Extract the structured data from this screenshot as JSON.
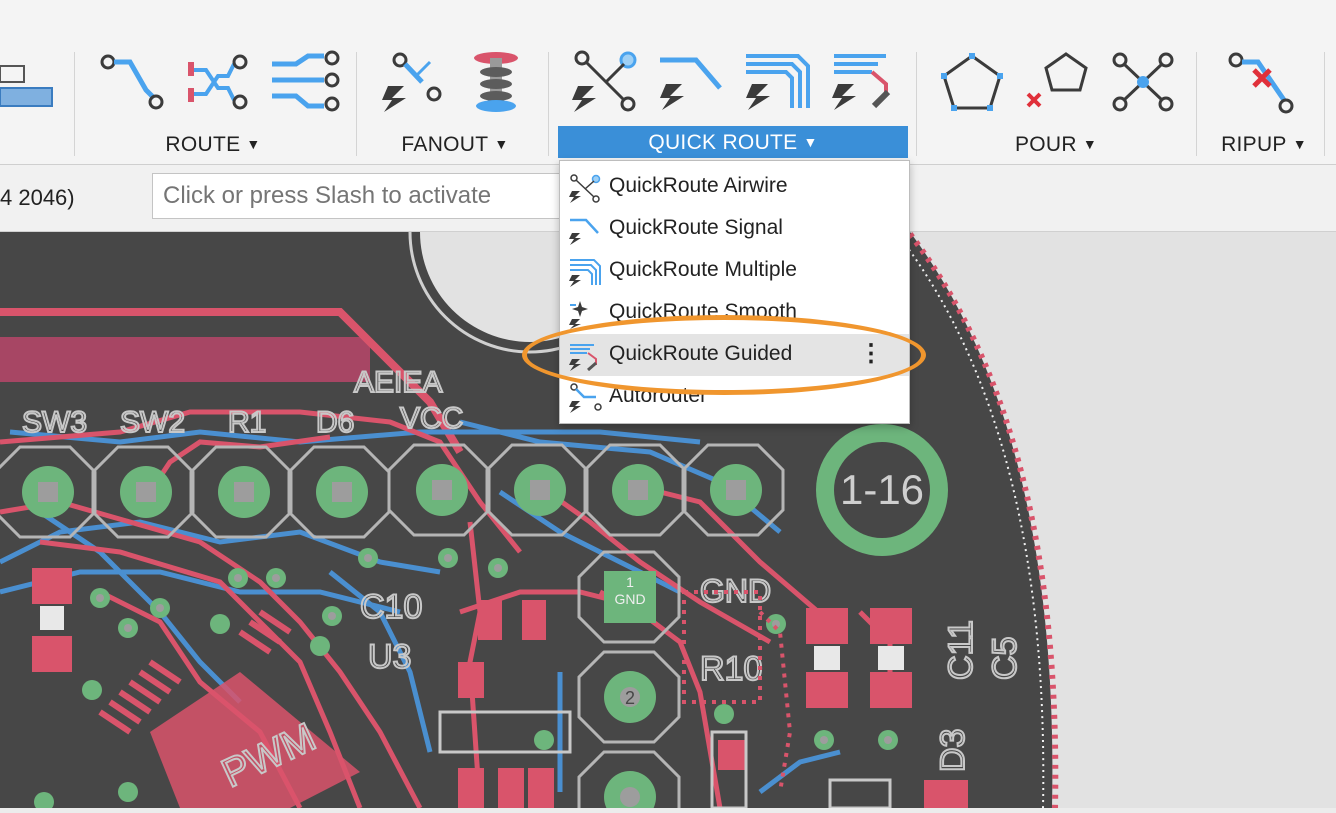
{
  "toolbar": {
    "groups": [
      {
        "label": "ROUTE",
        "tools": [
          "route-manual-icon",
          "route-differential-pair-icon",
          "route-multiple-icon"
        ]
      },
      {
        "label": "FANOUT",
        "tools": [
          "fanout-icon",
          "via-stack-icon"
        ]
      },
      {
        "label": "QUICK ROUTE",
        "tools": [
          "quickroute-airwire-icon",
          "quickroute-signal-icon",
          "quickroute-multiple-icon",
          "quickroute-guided-icon"
        ],
        "active": true
      },
      {
        "label": "POUR",
        "tools": [
          "polygon-icon",
          "ripup-polygon-icon",
          "name-polygon-icon"
        ]
      },
      {
        "label": "RIPUP",
        "tools": [
          "ripup-icon"
        ]
      }
    ],
    "caret": "▼"
  },
  "command_bar": {
    "coordinate": "4 2046)",
    "input_placeholder": "Click or press Slash to activate"
  },
  "dropdown": {
    "items": [
      {
        "label": "QuickRoute Airwire",
        "icon": "airwire-icon"
      },
      {
        "label": "QuickRoute Signal",
        "icon": "signal-icon"
      },
      {
        "label": "QuickRoute Multiple",
        "icon": "multiple-icon"
      },
      {
        "label": "QuickRoute Smooth",
        "icon": "smooth-icon"
      },
      {
        "label": "QuickRoute Guided",
        "icon": "guided-icon",
        "highlighted": true,
        "more": "⋮"
      },
      {
        "label": "Autorouter",
        "icon": "autorouter-icon"
      }
    ]
  },
  "pcb": {
    "silkscreen": [
      "SW3",
      "SW2",
      "R1",
      "D6",
      "AEIEA",
      "VCC",
      "1-16",
      "C10",
      "U3",
      "GND",
      "R10",
      "C11",
      "C5",
      "D3",
      "1",
      "2",
      "GND",
      "PWM"
    ],
    "colors": {
      "board": "#4a4a4a",
      "top_copper": "#d9546b",
      "bottom_copper": "#4a8fd0",
      "pad": "#6db57c",
      "silk": "#cfcfcf",
      "outline": "#d9546b"
    }
  }
}
